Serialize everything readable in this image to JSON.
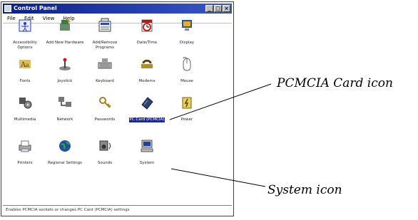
{
  "window": {
    "title": "Control Panel",
    "controls": {
      "minimize": "_",
      "maximize": "□",
      "close": "×"
    },
    "menu": [
      "File",
      "Edit",
      "View",
      "Help"
    ],
    "status_text": "Enables PCMCIA sockets or changes PC Card (PCMCIA) settings"
  },
  "icons": [
    {
      "id": "accessibility",
      "label": "Accessibility Options",
      "icon": "accessibility-icon"
    },
    {
      "id": "add-hardware",
      "label": "Add New Hardware",
      "icon": "add-hardware-icon"
    },
    {
      "id": "add-remove",
      "label": "Add/Remove Programs",
      "icon": "add-remove-programs-icon"
    },
    {
      "id": "datetime",
      "label": "Date/Time",
      "icon": "date-time-icon"
    },
    {
      "id": "display",
      "label": "Display",
      "icon": "display-icon"
    },
    {
      "id": "fonts",
      "label": "Fonts",
      "icon": "fonts-icon"
    },
    {
      "id": "joystick",
      "label": "Joystick",
      "icon": "joystick-icon"
    },
    {
      "id": "keyboard",
      "label": "Keyboard",
      "icon": "keyboard-icon"
    },
    {
      "id": "modems",
      "label": "Modems",
      "icon": "modem-icon"
    },
    {
      "id": "mouse",
      "label": "Mouse",
      "icon": "mouse-icon"
    },
    {
      "id": "multimedia",
      "label": "Multimedia",
      "icon": "multimedia-icon"
    },
    {
      "id": "network",
      "label": "Network",
      "icon": "network-icon"
    },
    {
      "id": "passwords",
      "label": "Passwords",
      "icon": "passwords-icon"
    },
    {
      "id": "pccard",
      "label": "PC Card (PCMCIA)",
      "icon": "pc-card-icon"
    },
    {
      "id": "power",
      "label": "Power",
      "icon": "power-icon"
    },
    {
      "id": "printers",
      "label": "Printers",
      "icon": "printers-icon"
    },
    {
      "id": "regional",
      "label": "Regional Settings",
      "icon": "regional-settings-icon"
    },
    {
      "id": "sounds",
      "label": "Sounds",
      "icon": "sounds-icon"
    },
    {
      "id": "system",
      "label": "System",
      "icon": "system-icon"
    }
  ],
  "selected_icon": "pccard",
  "callouts": {
    "pcmcia": "PCMCIA Card icon",
    "system": "System icon"
  }
}
